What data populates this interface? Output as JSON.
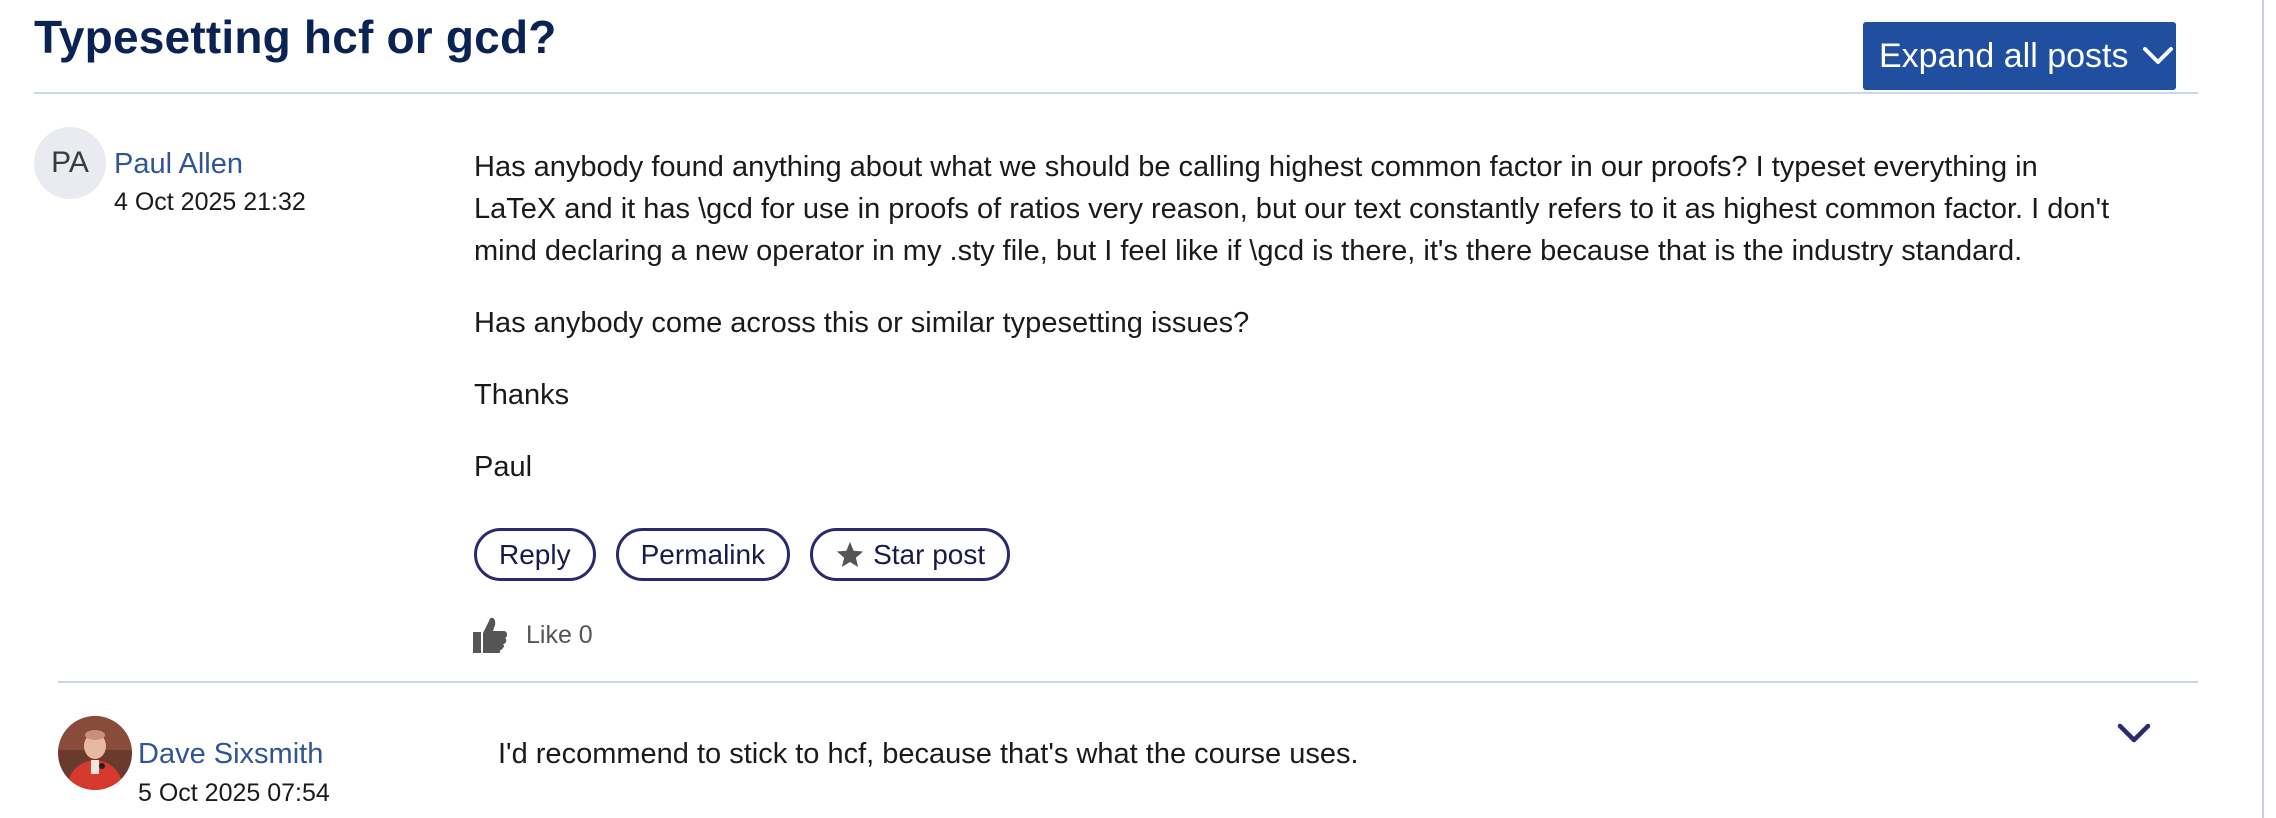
{
  "thread": {
    "title": "Typesetting hcf or gcd?",
    "expand_label": "Expand all posts"
  },
  "posts": [
    {
      "author": "Paul Allen",
      "initials": "PA",
      "date": "4 Oct 2025 21:32",
      "paragraphs": [
        "Has anybody found anything about what we should be calling highest common factor in our proofs? I typeset everything in LaTeX and it has \\gcd for use in proofs of ratios very reason, but our text constantly refers to it as highest common factor.  I don't mind declaring a new operator in my .sty file, but I feel like if \\gcd is there, it's there because that is the industry standard.",
        "Has anybody come across this or similar typesetting issues?",
        "Thanks",
        "Paul"
      ],
      "actions": {
        "reply": "Reply",
        "permalink": "Permalink",
        "star": "Star post"
      },
      "like_label": "Like 0"
    },
    {
      "author": "Dave Sixsmith",
      "date": "5 Oct 2025 07:54",
      "text": "I'd recommend to stick to hcf, because that's what the course uses."
    }
  ],
  "icons": {
    "expand": "chevron-down-icon",
    "star": "star-icon",
    "like": "thumbs-up-icon",
    "collapse": "chevron-down-icon"
  },
  "colors": {
    "title": "#0b2353",
    "expand_button": "#1f4f9e",
    "author_link": "#2f5597",
    "pill_border": "#2a2a6e",
    "divider": "#c8d8e8"
  }
}
